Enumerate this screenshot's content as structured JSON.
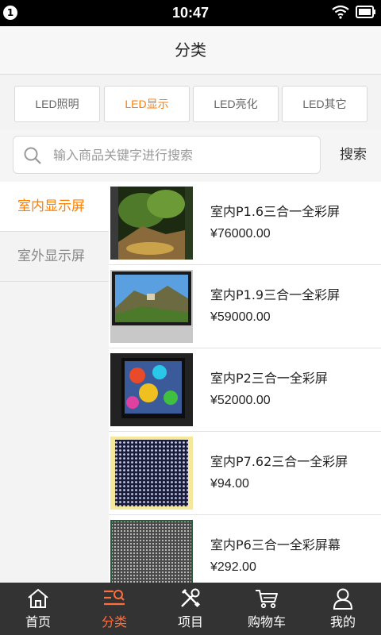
{
  "status": {
    "badge": "1",
    "time": "10:47"
  },
  "header": {
    "title": "分类"
  },
  "tabs": [
    {
      "label": "LED照明",
      "active": false
    },
    {
      "label": "LED显示",
      "active": true
    },
    {
      "label": "LED亮化",
      "active": false
    },
    {
      "label": "LED其它",
      "active": false
    }
  ],
  "search": {
    "placeholder": "输入商品关键字进行搜索",
    "button": "搜索"
  },
  "sidebar": {
    "items": [
      {
        "label": "室内显示屏",
        "active": true
      },
      {
        "label": "室外显示屏",
        "active": false
      }
    ]
  },
  "products": [
    {
      "name": "室内P1.6三合一全彩屏",
      "price": "¥76000.00",
      "thumb": "forest-scene"
    },
    {
      "name": "室内P1.9三合一全彩屏",
      "price": "¥59000.00",
      "thumb": "mountain-scene"
    },
    {
      "name": "室内P2三合一全彩屏",
      "price": "¥52000.00",
      "thumb": "colorful-birds"
    },
    {
      "name": "室内P7.62三合一全彩屏",
      "price": "¥94.00",
      "thumb": "led-module-yellow"
    },
    {
      "name": "室内P6三合一全彩屏幕",
      "price": "¥292.00",
      "thumb": "led-module-grid"
    }
  ],
  "nav": [
    {
      "label": "首页",
      "icon": "home-icon",
      "active": false
    },
    {
      "label": "分类",
      "icon": "category-icon",
      "active": true
    },
    {
      "label": "项目",
      "icon": "tools-icon",
      "active": false
    },
    {
      "label": "购物车",
      "icon": "cart-icon",
      "active": false
    },
    {
      "label": "我的",
      "icon": "user-icon",
      "active": false
    }
  ],
  "colors": {
    "accent": "#ff7e00",
    "nav_bg": "#333333",
    "nav_active": "#ff6d3a"
  }
}
